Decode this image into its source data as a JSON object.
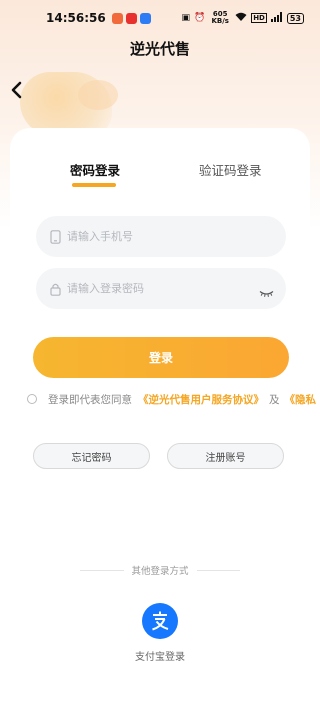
{
  "status_bar": {
    "time": "14:56:56",
    "network_speed": "605 KB/s",
    "battery": "53"
  },
  "nav": {
    "title": "逆光代售"
  },
  "tabs": [
    {
      "label": "密码登录",
      "active": true
    },
    {
      "label": "验证码登录",
      "active": false
    }
  ],
  "form": {
    "phone_placeholder": "请输入手机号",
    "password_placeholder": "请输入登录密码",
    "login_label": "登录"
  },
  "agreement": {
    "prefix": "登录即代表您同意",
    "service_link": "《逆光代售用户服务协议》",
    "and": "及",
    "privacy_link": "《隐私"
  },
  "secondary_buttons": {
    "forgot": "忘记密码",
    "register": "注册账号"
  },
  "other_login": {
    "title": "其他登录方式",
    "alipay_label": "支付宝登录"
  },
  "colors": {
    "accent": "#f5a623",
    "alipay": "#1677ff"
  }
}
